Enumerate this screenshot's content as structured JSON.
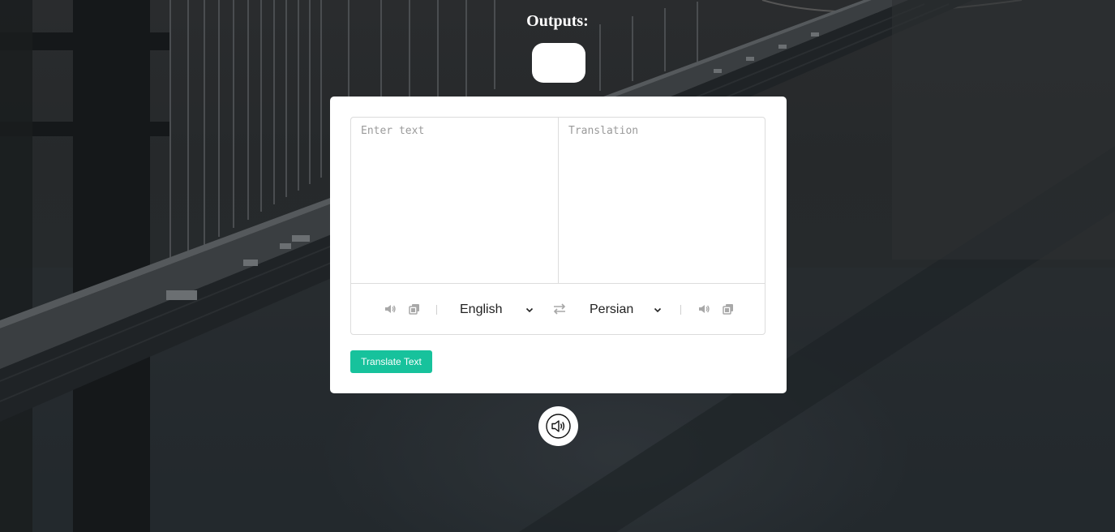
{
  "header": {
    "title": "Outputs:"
  },
  "output": {
    "value": ""
  },
  "translator": {
    "from_placeholder": "Enter text",
    "to_placeholder": "Translation",
    "from_language": "English",
    "to_language": "Persian",
    "translate_label": "Translate Text"
  },
  "icons": {
    "from_speak": "volume-icon",
    "from_copy": "copy-icon",
    "exchange": "exchange-icon",
    "to_speak": "volume-icon",
    "to_copy": "copy-icon",
    "speak_main": "speaker-icon"
  },
  "colors": {
    "accent": "#17c29c",
    "card": "#ffffff",
    "icon": "#a8a8a8"
  }
}
